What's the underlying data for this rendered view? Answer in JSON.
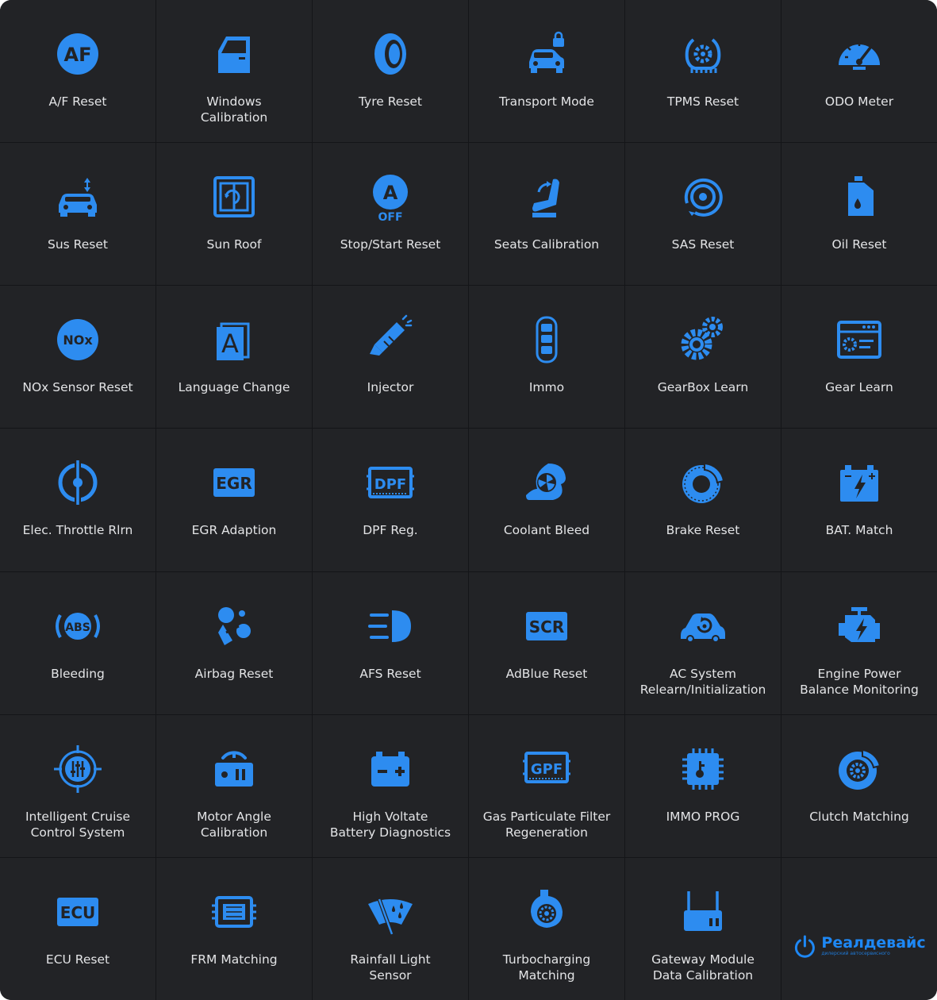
{
  "theme": {
    "accent": "#2d8cf0",
    "background": "#222326",
    "text": "#e3e4e6"
  },
  "grid": [
    {
      "label": "A/F Reset",
      "icon": "af-icon"
    },
    {
      "label": "Windows\nCalibration",
      "icon": "car-door-icon"
    },
    {
      "label": "Tyre Reset",
      "icon": "tyre-icon"
    },
    {
      "label": "Transport Mode",
      "icon": "car-lock-icon"
    },
    {
      "label": "TPMS Reset",
      "icon": "tpms-icon"
    },
    {
      "label": "ODO Meter",
      "icon": "odometer-icon"
    },
    {
      "label": "Sus Reset",
      "icon": "car-suspension-icon"
    },
    {
      "label": "Sun Roof",
      "icon": "sunroof-icon"
    },
    {
      "label": "Stop/Start Reset",
      "icon": "auto-stop-off-icon"
    },
    {
      "label": "Seats Calibration",
      "icon": "seat-icon"
    },
    {
      "label": "SAS Reset",
      "icon": "steering-wheel-icon"
    },
    {
      "label": "Oil Reset",
      "icon": "oil-can-icon"
    },
    {
      "label": "NOx Sensor Reset",
      "icon": "nox-icon"
    },
    {
      "label": "Language Change",
      "icon": "language-icon"
    },
    {
      "label": "Injector",
      "icon": "injector-icon"
    },
    {
      "label": "Immo",
      "icon": "car-key-icon"
    },
    {
      "label": "GearBox Learn",
      "icon": "gears-icon"
    },
    {
      "label": "Gear Learn",
      "icon": "gear-window-icon"
    },
    {
      "label": "Elec. Throttle Rlrn",
      "icon": "throttle-icon"
    },
    {
      "label": "EGR Adaption",
      "icon": "egr-icon"
    },
    {
      "label": "DPF Reg.",
      "icon": "dpf-icon"
    },
    {
      "label": "Coolant Bleed",
      "icon": "coolant-fan-icon"
    },
    {
      "label": "Brake Reset",
      "icon": "brake-disc-icon"
    },
    {
      "label": "BAT. Match",
      "icon": "battery-bolt-icon"
    },
    {
      "label": "Bleeding",
      "icon": "abs-icon"
    },
    {
      "label": "Airbag Reset",
      "icon": "airbag-icon"
    },
    {
      "label": "AFS Reset",
      "icon": "headlight-icon"
    },
    {
      "label": "AdBlue Reset",
      "icon": "scr-icon"
    },
    {
      "label": "AC System\nRelearn/Initialization",
      "icon": "car-ac-icon"
    },
    {
      "label": "Engine Power\nBalance Monitoring",
      "icon": "engine-icon"
    },
    {
      "label": "Intelligent Cruise\nControl System",
      "icon": "cruise-control-icon"
    },
    {
      "label": "Motor Angle\nCalibration",
      "icon": "motor-angle-icon"
    },
    {
      "label": "High Voltate\nBattery Diagnostics",
      "icon": "hv-battery-icon"
    },
    {
      "label": "Gas Particulate Filter\nRegeneration",
      "icon": "gpf-icon"
    },
    {
      "label": "IMMO PROG",
      "icon": "chip-icon"
    },
    {
      "label": "Clutch Matching",
      "icon": "clutch-icon"
    },
    {
      "label": "ECU Reset",
      "icon": "ecu-icon"
    },
    {
      "label": "FRM Matching",
      "icon": "frm-module-icon"
    },
    {
      "label": "Rainfall Light\nSensor",
      "icon": "wiper-icon"
    },
    {
      "label": "Turbocharging\nMatching",
      "icon": "turbo-icon"
    },
    {
      "label": "Gateway Module\nData Calibration",
      "icon": "gateway-router-icon"
    }
  ],
  "watermark": {
    "name": "Реалдевайс",
    "tagline": "дилерский автосервисного",
    "icon": "power-logo-icon"
  }
}
